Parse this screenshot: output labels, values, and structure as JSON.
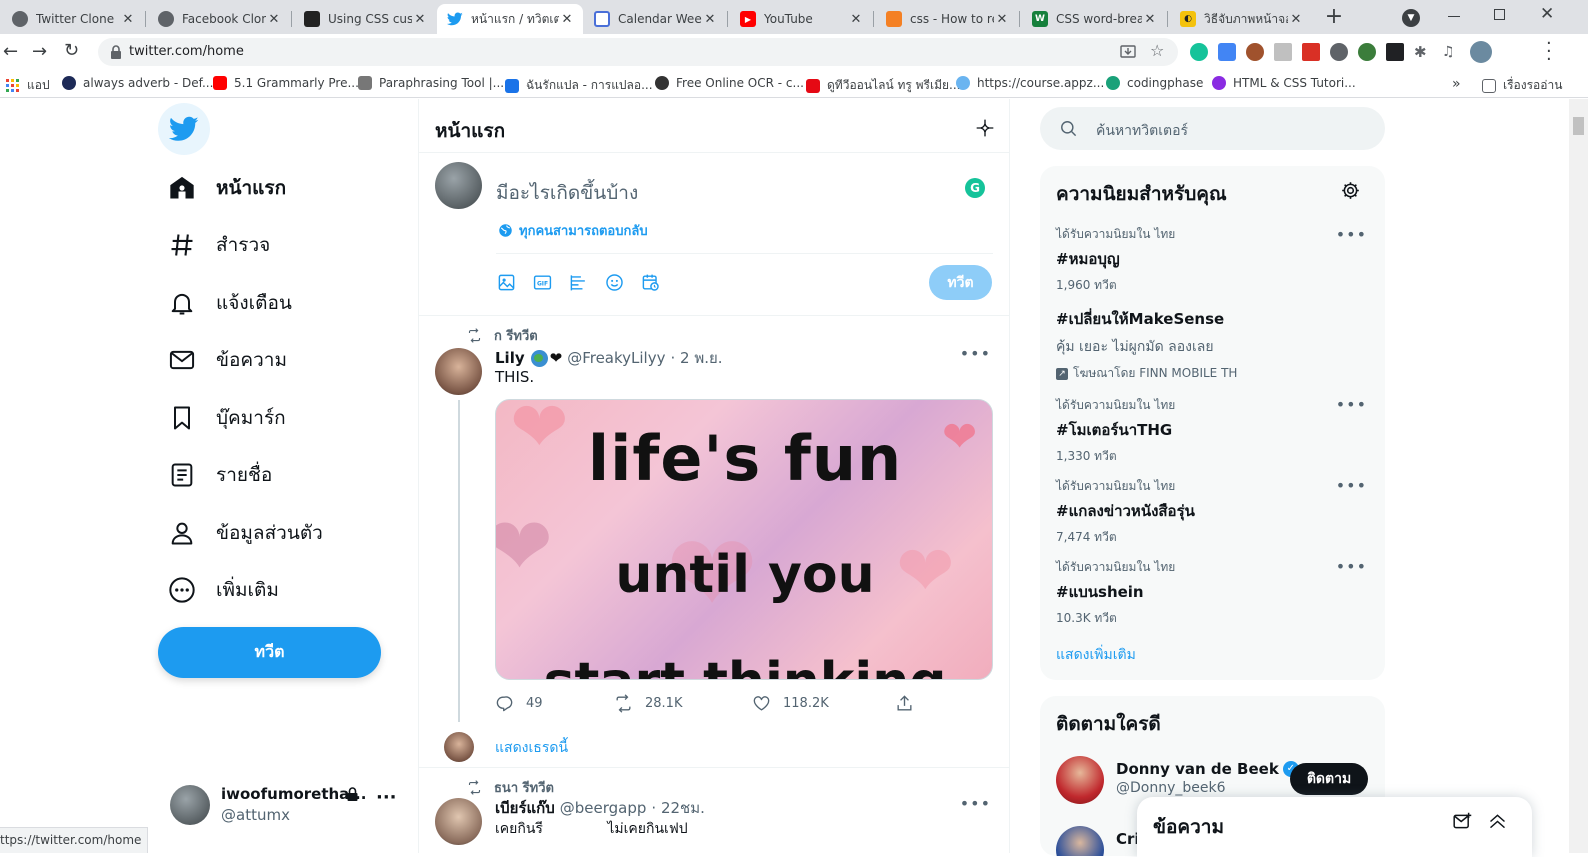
{
  "browser": {
    "tabs": [
      {
        "title": "Twitter Clone",
        "fav": "#5f6368"
      },
      {
        "title": "Facebook Clone",
        "fav": "#5f6368"
      },
      {
        "title": "Using CSS custo",
        "fav": "#222"
      },
      {
        "title": "หน้าแรก / ทวิตเตอ",
        "fav": "#1d9bf0"
      },
      {
        "title": "Calendar Week",
        "fav": "#4a6fd8"
      },
      {
        "title": "YouTube",
        "fav": "#ff0000"
      },
      {
        "title": "css - How to rer",
        "fav": "#f48024"
      },
      {
        "title": "CSS word-break",
        "fav": "#16803c"
      },
      {
        "title": "วิธีจับภาพหน้าจอใน",
        "fav": "#f4c20d"
      }
    ],
    "url": "twitter.com/home",
    "bookmarks": [
      {
        "label": "แอป",
        "color": "#ea4335"
      },
      {
        "label": "always adverb - Def...",
        "color": "#1d2a57"
      },
      {
        "label": "5.1 Grammarly Pre...",
        "color": "#ff0000"
      },
      {
        "label": "Paraphrasing Tool |...",
        "color": "#777777"
      },
      {
        "label": "ฉันรักแปล - การแปลอ...",
        "color": "#1a73e8"
      },
      {
        "label": "Free Online OCR - c...",
        "color": "#333333"
      },
      {
        "label": "ดูทีวีออนไลน์ ทรู พรีเมีย...",
        "color": "#e50914"
      },
      {
        "label": "https://course.appz...",
        "color": "#6ab4f0"
      },
      {
        "label": "codingphase",
        "color": "#1aa179"
      },
      {
        "label": "HTML & CSS Tutori...",
        "color": "#8a2be2"
      }
    ],
    "reading_list": "เรื่องรออ่าน",
    "status_url": "ttps://twitter.com/home"
  },
  "nav": {
    "items": [
      "หน้าแรก",
      "สำรวจ",
      "แจ้งเตือน",
      "ข้อความ",
      "บุ๊คมาร์ก",
      "รายชื่อ",
      "ข้อมูลส่วนตัว",
      "เพิ่มเติม"
    ],
    "tweet_button": "ทวีต",
    "account_name": "iwoofumoretha...",
    "account_handle": "@attumx"
  },
  "header": {
    "title": "หน้าแรก"
  },
  "composer": {
    "placeholder": "มีอะไรเกิดขึ้นบ้าง",
    "reply_setting": "ทุกคนสามารถตอบกลับ",
    "tweet_button": "ทวีต"
  },
  "tweets": [
    {
      "retweet_by": "ก รีทวีต",
      "name": "Lily",
      "handle": "@FreakyLilyy",
      "time": "· 2 พ.ย.",
      "text": "THIS.",
      "image_text": [
        "life's fun",
        "until you",
        "start thinking"
      ],
      "replies": "49",
      "retweets": "28.1K",
      "likes": "118.2K",
      "show_thread": "แสดงเธรดนี้"
    },
    {
      "retweet_by": "ธนา รีทวีต",
      "name": "เบียร์แก๊บ",
      "handle": "@beergapp",
      "time": "· 22ชม.",
      "text_a": "เคยกินรี",
      "text_b": "ไม่เคยกินเฟป"
    }
  ],
  "search": {
    "placeholder": "ค้นหาทวิตเตอร์"
  },
  "trends": {
    "title": "ความนิยมสำหรับคุณ",
    "items": [
      {
        "context": "ได้รับความนิยมใน ไทย",
        "name": "#หมอบุญ",
        "count": "1,960 ทวีต"
      },
      {
        "name": "#เปลี่ยนให้MakeSense",
        "desc": "คุ้ม เยอะ ไม่ผูกมัด ลองเลย",
        "promoted": "โฆษณาโดย FINN MOBILE TH"
      },
      {
        "context": "ได้รับความนิยมใน ไทย",
        "name": "#โมเตอร์นาTHG",
        "count": "1,330 ทวีต"
      },
      {
        "context": "ได้รับความนิยมใน ไทย",
        "name": "#แกลงข่าวหนังสือรุ่น",
        "count": "7,474 ทวีต"
      },
      {
        "context": "ได้รับความนิยมใน ไทย",
        "name": "#แบนshein",
        "count": "10.3K ทวีต"
      }
    ],
    "show_more": "แสดงเพิ่มเติม"
  },
  "who_to_follow": {
    "title": "ติดตามใครดี",
    "user_name": "Donny van de Beek",
    "user_handle": "@Donny_beek6",
    "follow": "ติดตาม",
    "next_name": "Cri"
  },
  "messages": {
    "title": "ข้อความ"
  },
  "colors": {
    "brand": "#1d9bf0",
    "text": "#0f1419",
    "muted": "#536471"
  }
}
